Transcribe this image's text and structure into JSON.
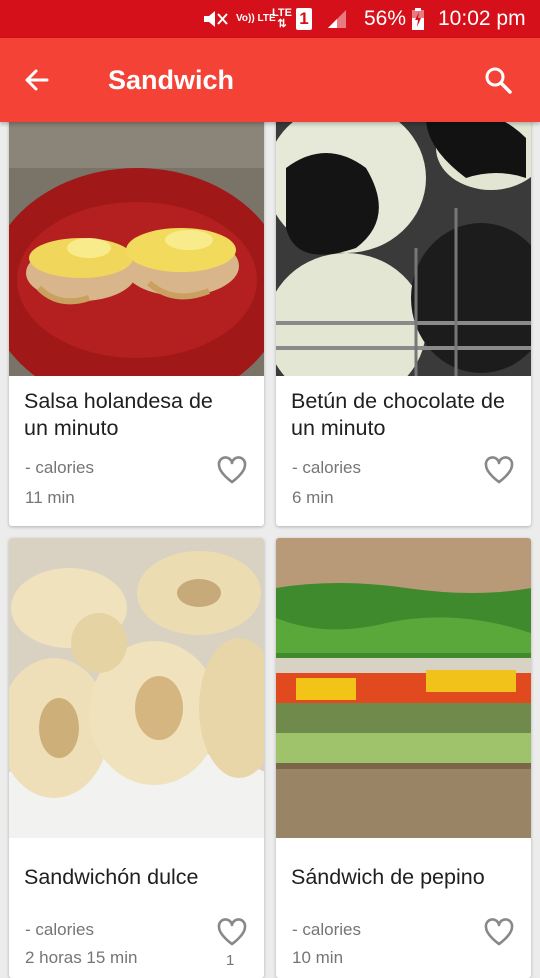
{
  "status_bar": {
    "volte": "Vo)) LTE",
    "network": "LTE",
    "sim_slot": "1",
    "battery_percent": "56%",
    "time": "10:02 pm",
    "icons": [
      "mute-icon",
      "signal-icon",
      "battery-charging-icon"
    ]
  },
  "app_bar": {
    "title": "Sandwich",
    "color": "#f44336",
    "status_color": "#d6101a",
    "icons": [
      "back-arrow-icon",
      "search-icon"
    ]
  },
  "recipes": [
    {
      "title": "Salsa holandesa de un minuto",
      "calories": "- calories",
      "time": "11 min",
      "favorite_icon": "heart-outline-icon"
    },
    {
      "title": "Betún de chocolate de un minuto",
      "calories": "- calories",
      "time": "6 min",
      "favorite_icon": "heart-outline-icon"
    },
    {
      "title": "Sandwichón dulce",
      "calories": "- calories",
      "time": "2 horas 15 min",
      "favorites": "1",
      "favorite_icon": "heart-outline-icon"
    },
    {
      "title": "Sándwich de pepino",
      "calories": "- calories",
      "time": "10 min",
      "favorite_icon": "heart-outline-icon"
    }
  ]
}
